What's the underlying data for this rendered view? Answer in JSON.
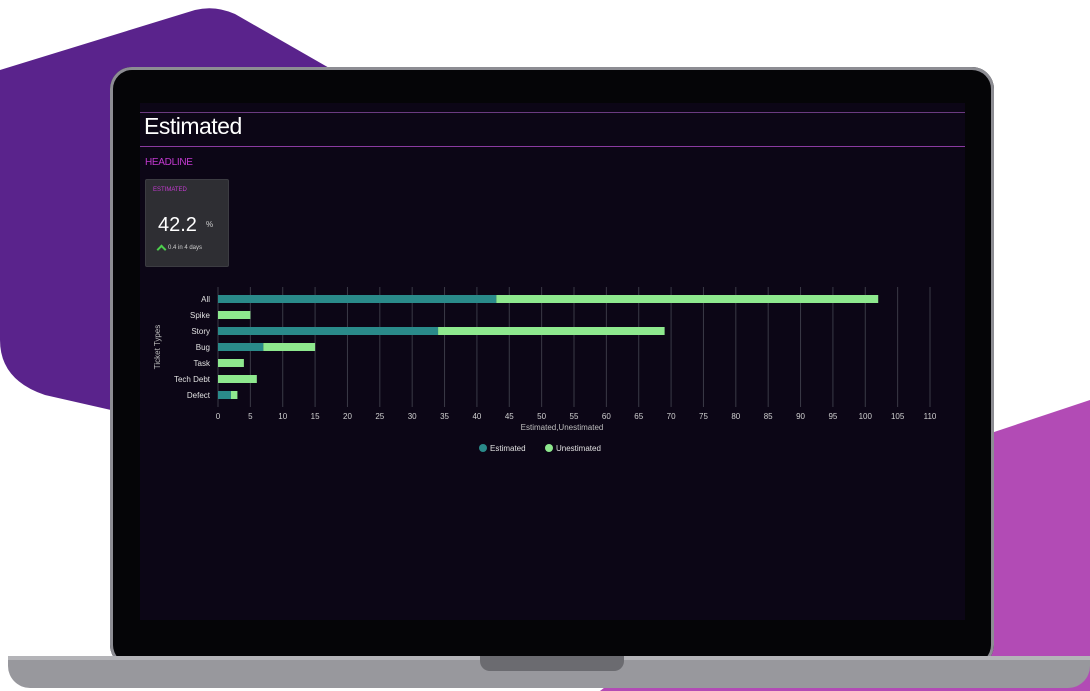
{
  "dashboard": {
    "title": "Estimated",
    "section": "HEADLINE"
  },
  "kpi": {
    "label": "ESTIMATED",
    "value": "42.2",
    "unit": "%",
    "delta": "0.4 in 4 days",
    "trend": "up"
  },
  "colors": {
    "estimated": "#2a8a8a",
    "unestimated": "#8ee88e",
    "accent": "#c33ad0"
  },
  "chart_data": {
    "type": "bar",
    "orientation": "horizontal",
    "stacked": true,
    "categories": [
      "All",
      "Spike",
      "Story",
      "Bug",
      "Task",
      "Tech Debt",
      "Defect"
    ],
    "series": [
      {
        "name": "Estimated",
        "values": [
          43,
          0,
          34,
          7,
          0,
          0,
          2
        ]
      },
      {
        "name": "Unestimated",
        "values": [
          59,
          5,
          35,
          8,
          4,
          6,
          1
        ]
      }
    ],
    "xlabel": "Estimated,Unestimated",
    "ylabel": "Ticket Types",
    "xlim": [
      0,
      110
    ],
    "xticks": [
      0,
      5,
      10,
      15,
      20,
      25,
      30,
      35,
      40,
      45,
      50,
      55,
      60,
      65,
      70,
      75,
      80,
      85,
      90,
      95,
      100,
      105,
      110
    ],
    "grid": true,
    "legend": "bottom"
  }
}
